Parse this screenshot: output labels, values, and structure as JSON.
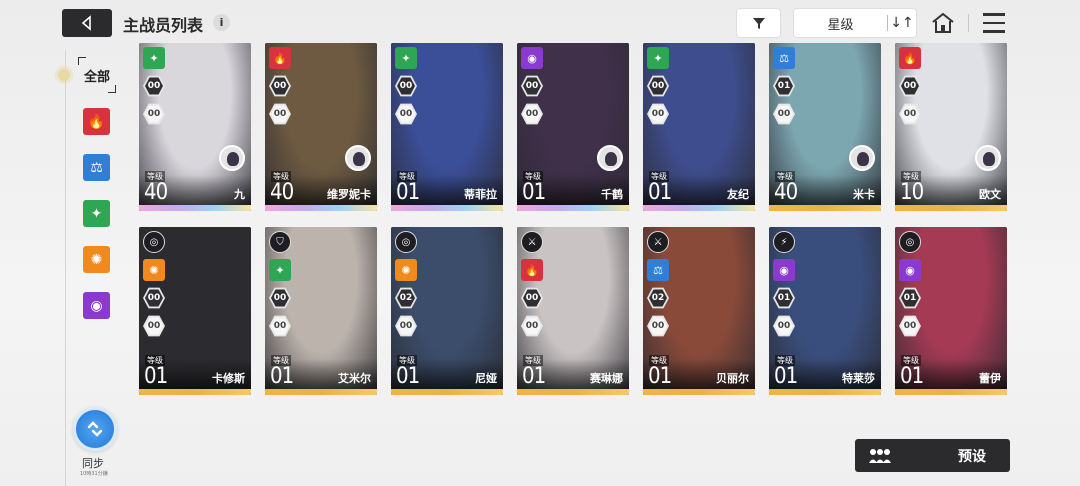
{
  "header": {
    "title": "主战员列表",
    "info_glyph": "i",
    "sort_label": "星级",
    "sort_dir_glyph": "↓↑"
  },
  "sidebar": {
    "all_label": "全部",
    "filters": [
      {
        "name": "fire",
        "color": "#d9323f",
        "glyph": "🔥"
      },
      {
        "name": "balance",
        "color": "#2f7fd6",
        "glyph": "⚖"
      },
      {
        "name": "wind",
        "color": "#2fa653",
        "glyph": "✦"
      },
      {
        "name": "sun",
        "color": "#f08a1c",
        "glyph": "✺"
      },
      {
        "name": "void",
        "color": "#8b3ad0",
        "glyph": "◉"
      }
    ],
    "sync_label": "同步",
    "sync_sub": "10時31分鐘"
  },
  "cards": [
    {
      "name": "九",
      "level": "40",
      "level_label": "等级",
      "element": "wind",
      "rank1": "00",
      "rank2": "00",
      "bar": "#c8a9f0",
      "art": "#d9d6dc",
      "mini": true
    },
    {
      "name": "维罗妮卡",
      "level": "40",
      "level_label": "等级",
      "element": "fire",
      "rank1": "00",
      "rank2": "00",
      "bar": "#c8a9f0",
      "art": "#6d5a41",
      "mini": true
    },
    {
      "name": "蒂菲拉",
      "level": "01",
      "level_label": "等级",
      "element": "wind",
      "rank1": "00",
      "rank2": "00",
      "bar": "#c8a9f0",
      "art": "#3b4e98",
      "mini": false
    },
    {
      "name": "千鹤",
      "level": "01",
      "level_label": "等级",
      "element": "void",
      "rank1": "00",
      "rank2": "00",
      "bar": "#c8a9f0",
      "art": "#40304a",
      "mini": true
    },
    {
      "name": "友纪",
      "level": "01",
      "level_label": "等级",
      "element": "wind",
      "rank1": "00",
      "rank2": "00",
      "bar": "#c8a9f0",
      "art": "#3e4d8d",
      "mini": false
    },
    {
      "name": "米卡",
      "level": "40",
      "level_label": "等级",
      "element": "balance",
      "rank1": "01",
      "rank2": "00",
      "bar": "#e8b24a",
      "art": "#7ca6b0",
      "mini": true
    },
    {
      "name": "欧文",
      "level": "10",
      "level_label": "等级",
      "element": "fire",
      "rank1": "00",
      "rank2": "00",
      "bar": "#e8b24a",
      "art": "#dfe1e6",
      "mini": true
    },
    {
      "name": "卡修斯",
      "level": "01",
      "level_label": "等级",
      "element": "sun",
      "rank1": "00",
      "rank2": "00",
      "bar": "#e8b24a",
      "art": "#2c2c30",
      "weapon": "◎",
      "mini": false
    },
    {
      "name": "艾米尔",
      "level": "01",
      "level_label": "等级",
      "element": "wind",
      "rank1": "00",
      "rank2": "00",
      "bar": "#e8b24a",
      "art": "#bcb3ac",
      "weapon": "⛉",
      "mini": false
    },
    {
      "name": "尼娅",
      "level": "01",
      "level_label": "等级",
      "element": "sun",
      "rank1": "02",
      "rank2": "00",
      "bar": "#e8b24a",
      "art": "#3b4d6b",
      "weapon": "◎",
      "mini": false
    },
    {
      "name": "赛琳娜",
      "level": "01",
      "level_label": "等级",
      "element": "fire",
      "rank1": "00",
      "rank2": "00",
      "bar": "#e8b24a",
      "art": "#c9c3c3",
      "weapon": "⚔",
      "mini": false
    },
    {
      "name": "贝丽尔",
      "level": "01",
      "level_label": "等级",
      "element": "balance",
      "rank1": "02",
      "rank2": "00",
      "bar": "#e8b24a",
      "art": "#8a4a3a",
      "weapon": "⚔",
      "mini": false
    },
    {
      "name": "特莱莎",
      "level": "01",
      "level_label": "等级",
      "element": "void",
      "rank1": "01",
      "rank2": "00",
      "bar": "#e8b24a",
      "art": "#3a4e7e",
      "weapon": "⚡",
      "mini": false
    },
    {
      "name": "蕾伊",
      "level": "01",
      "level_label": "等级",
      "element": "void",
      "rank1": "01",
      "rank2": "00",
      "bar": "#e8b24a",
      "art": "#a43a54",
      "weapon": "◎",
      "mini": false
    }
  ],
  "preset_label": "预设"
}
